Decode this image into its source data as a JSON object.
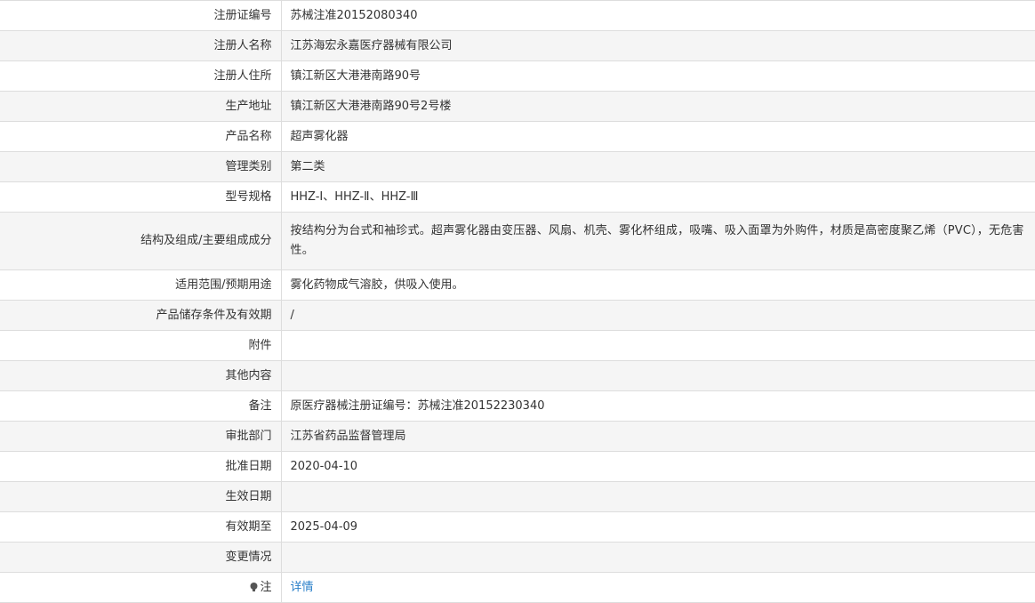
{
  "rows": [
    {
      "label": "注册证编号",
      "value": "苏械注准20152080340"
    },
    {
      "label": "注册人名称",
      "value": "江苏海宏永嘉医疗器械有限公司"
    },
    {
      "label": "注册人住所",
      "value": "镇江新区大港港南路90号"
    },
    {
      "label": "生产地址",
      "value": "镇江新区大港港南路90号2号楼"
    },
    {
      "label": "产品名称",
      "value": "超声雾化器"
    },
    {
      "label": "管理类别",
      "value": "第二类"
    },
    {
      "label": "型号规格",
      "value": "HHZ-Ⅰ、HHZ-Ⅱ、HHZ-Ⅲ"
    },
    {
      "label": "结构及组成/主要组成成分",
      "value": "按结构分为台式和袖珍式。超声雾化器由变压器、风扇、机壳、雾化杯组成，吸嘴、吸入面罩为外购件，材质是高密度聚乙烯（PVC），无危害性。"
    },
    {
      "label": "适用范围/预期用途",
      "value": "雾化药物成气溶胶，供吸入使用。"
    },
    {
      "label": "产品储存条件及有效期",
      "value": "/"
    },
    {
      "label": "附件",
      "value": ""
    },
    {
      "label": "其他内容",
      "value": ""
    },
    {
      "label": "备注",
      "value": "原医疗器械注册证编号：苏械注准20152230340"
    },
    {
      "label": "审批部门",
      "value": "江苏省药品监督管理局"
    },
    {
      "label": "批准日期",
      "value": "2020-04-10"
    },
    {
      "label": "生效日期",
      "value": ""
    },
    {
      "label": "有效期至",
      "value": "2025-04-09"
    },
    {
      "label": "变更情况",
      "value": ""
    }
  ],
  "note_row": {
    "label": "注",
    "icon": "bulb-icon",
    "link": "详情"
  },
  "colors": {
    "border": "#dddddd",
    "stripe": "#f5f5f5",
    "text": "#333333",
    "link": "#2a7fc9"
  }
}
